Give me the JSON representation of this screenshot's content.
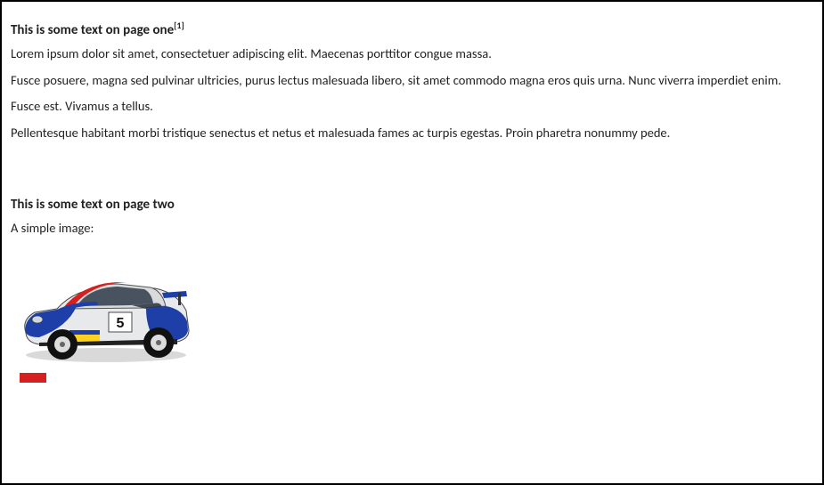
{
  "page1": {
    "heading": "This is some text on page one",
    "footnote_ref": "[1]",
    "p1": "Lorem ipsum dolor sit amet, consectetuer adipiscing elit. Maecenas porttitor congue massa.",
    "p2": "Fusce posuere, magna sed pulvinar ultricies, purus lectus malesuada libero, sit amet commodo magna eros quis urna. Nunc viverra imperdiet enim.",
    "p3": "Fusce est. Vivamus a tellus.",
    "p4": "Pellentesque habitant morbi tristique senectus et netus et malesuada fames ac turpis egestas. Proin pharetra nonummy pede."
  },
  "page2": {
    "heading": "This is some text on page two",
    "caption": "A simple image:",
    "image_alt": "rally-car"
  }
}
